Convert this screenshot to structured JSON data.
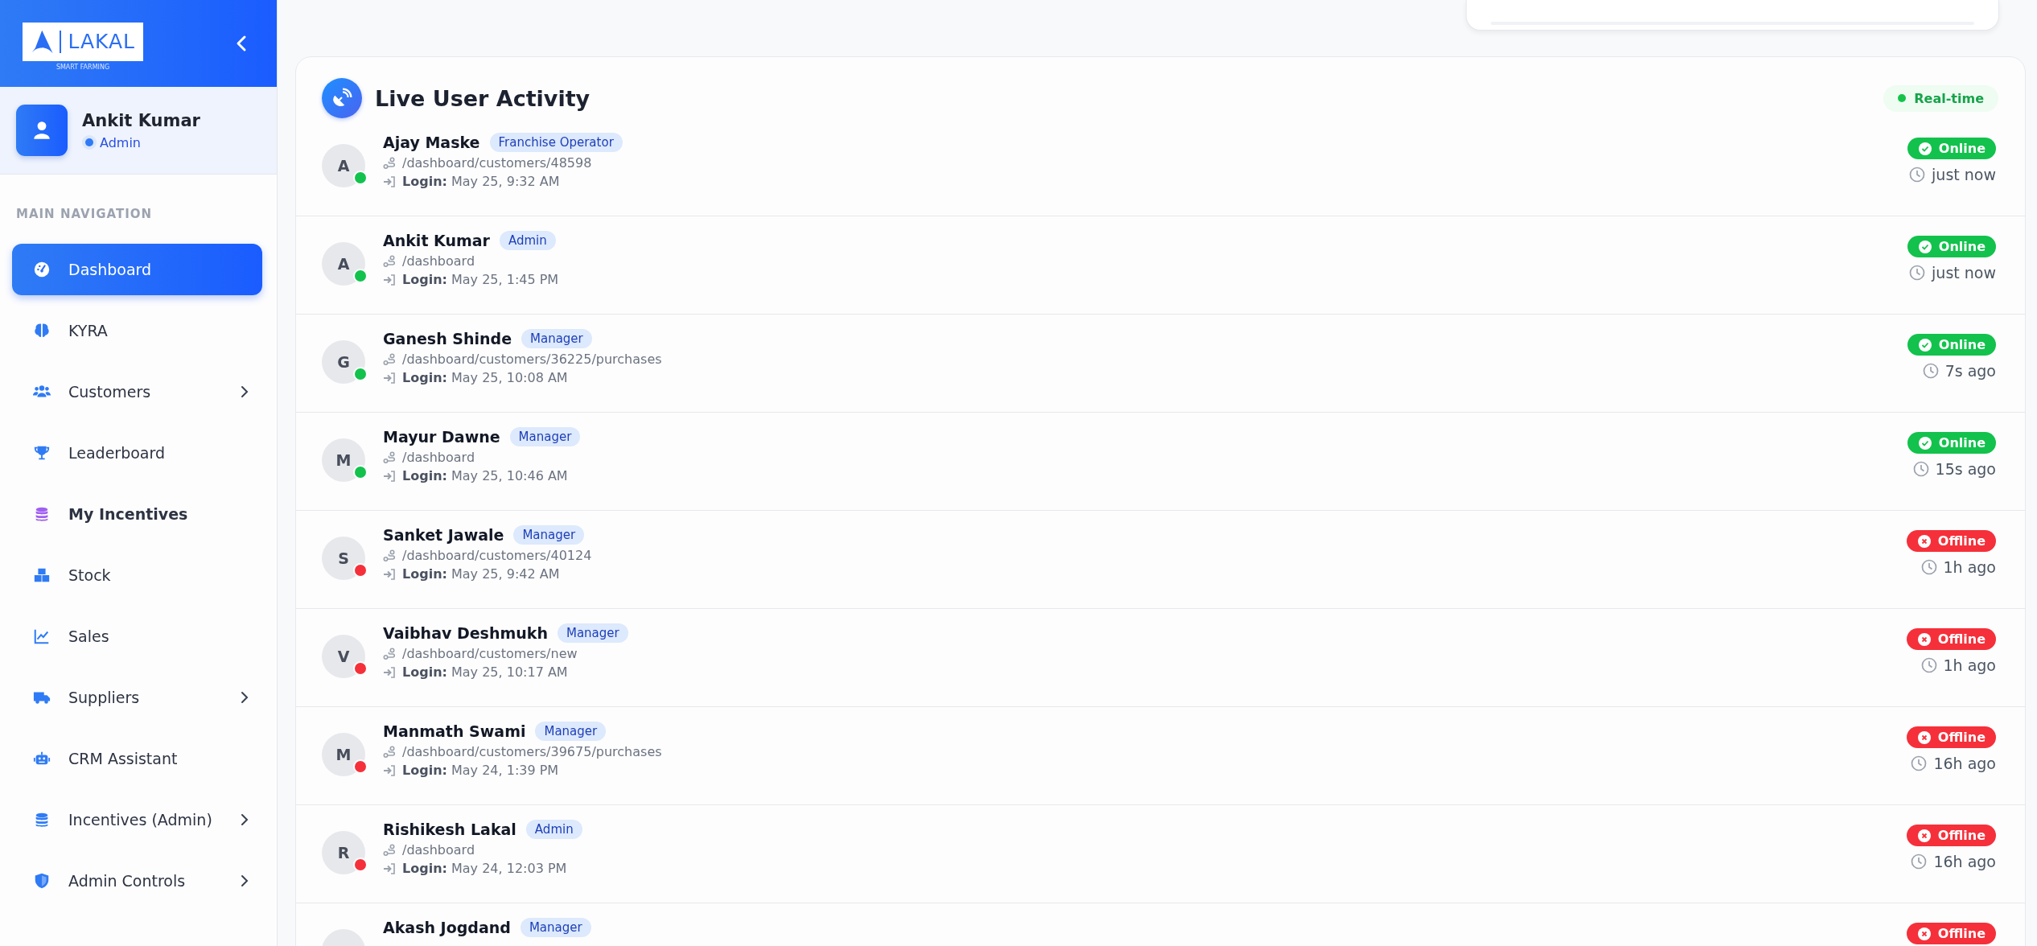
{
  "sidebar": {
    "logo": {
      "name": "LAKAL",
      "tagline": "SMART FARMING"
    },
    "profile": {
      "name": "Ankit Kumar",
      "role": "Admin"
    },
    "section_label": "MAIN NAVIGATION",
    "items": [
      {
        "label": "Dashboard",
        "selected": true,
        "highlighted": false,
        "has_submenu": false
      },
      {
        "label": "KYRA",
        "selected": false,
        "highlighted": false,
        "has_submenu": false
      },
      {
        "label": "Customers",
        "selected": false,
        "highlighted": false,
        "has_submenu": true
      },
      {
        "label": "Leaderboard",
        "selected": false,
        "highlighted": false,
        "has_submenu": false
      },
      {
        "label": "My Incentives",
        "selected": false,
        "highlighted": true,
        "has_submenu": false
      },
      {
        "label": "Stock",
        "selected": false,
        "highlighted": false,
        "has_submenu": false
      },
      {
        "label": "Sales",
        "selected": false,
        "highlighted": false,
        "has_submenu": false
      },
      {
        "label": "Suppliers",
        "selected": false,
        "highlighted": false,
        "has_submenu": true
      },
      {
        "label": "CRM Assistant",
        "selected": false,
        "highlighted": false,
        "has_submenu": false
      },
      {
        "label": "Incentives (Admin)",
        "selected": false,
        "highlighted": false,
        "has_submenu": true
      },
      {
        "label": "Admin Controls",
        "selected": false,
        "highlighted": false,
        "has_submenu": true
      }
    ]
  },
  "activity": {
    "title": "Live User Activity",
    "live_label": "Real-time",
    "users": [
      {
        "initial": "A",
        "name": "Ajay Maske",
        "role": "Franchise Operator",
        "path": "/dashboard/customers/48598",
        "login": "**Login:** May 25, 9:32 AM",
        "online": true,
        "status": "Online",
        "last_seen": "just now"
      },
      {
        "initial": "A",
        "name": "Ankit Kumar",
        "role": "Admin",
        "path": "/dashboard",
        "login": "**Login:** May 25, 1:45 PM",
        "online": true,
        "status": "Online",
        "last_seen": "just now"
      },
      {
        "initial": "G",
        "name": "Ganesh Shinde",
        "role": "Manager",
        "path": "/dashboard/customers/36225/purchases",
        "login": "**Login:** May 25, 10:08 AM",
        "online": true,
        "status": "Online",
        "last_seen": "7s ago"
      },
      {
        "initial": "M",
        "name": "Mayur Dawne",
        "role": "Manager",
        "path": "/dashboard",
        "login": "**Login:** May 25, 10:46 AM",
        "online": true,
        "status": "Online",
        "last_seen": "15s ago"
      },
      {
        "initial": "S",
        "name": "Sanket Jawale",
        "role": "Manager",
        "path": "/dashboard/customers/40124",
        "login": "**Login:** May 25, 9:42 AM",
        "online": false,
        "status": "Offline",
        "last_seen": "1h ago"
      },
      {
        "initial": "V",
        "name": "Vaibhav Deshmukh",
        "role": "Manager",
        "path": "/dashboard/customers/new",
        "login": "**Login:** May 25, 10:17 AM",
        "online": false,
        "status": "Offline",
        "last_seen": "1h ago"
      },
      {
        "initial": "M",
        "name": "Manmath Swami",
        "role": "Manager",
        "path": "/dashboard/customers/39675/purchases",
        "login": "**Login:** May 24, 1:39 PM",
        "online": false,
        "status": "Offline",
        "last_seen": "16h ago"
      },
      {
        "initial": "R",
        "name": "Rishikesh Lakal",
        "role": "Admin",
        "path": "/dashboard",
        "login": "**Login:** May 24, 12:03 PM",
        "online": false,
        "status": "Offline",
        "last_seen": "16h ago"
      },
      {
        "name": "Akash Jogdand",
        "role": "Manager",
        "online": false,
        "status": "Offline"
      }
    ]
  }
}
